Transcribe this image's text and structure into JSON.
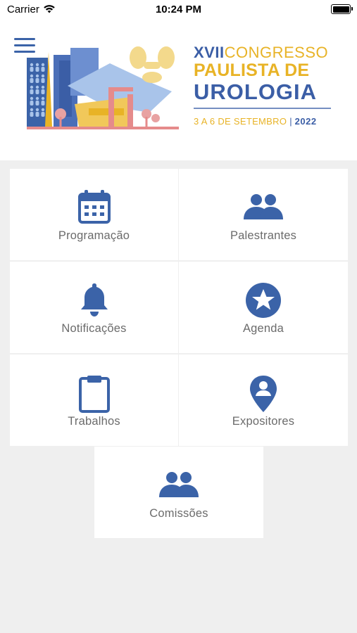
{
  "status_bar": {
    "carrier": "Carrier",
    "time": "10:24 PM"
  },
  "header": {
    "menu_icon": "hamburger-menu-icon",
    "brand": {
      "line1_roman": "XVII",
      "line1_word": "CONGRESSO",
      "line2": "PAULISTA DE",
      "line3": "UROLOGIA",
      "dates": "3 A 6 DE SETEMBRO",
      "separator": "|",
      "year": "2022"
    }
  },
  "menu": {
    "items": [
      {
        "label": "Programação",
        "icon": "calendar-icon"
      },
      {
        "label": "Palestrantes",
        "icon": "people-icon"
      },
      {
        "label": "Notificações",
        "icon": "bell-icon"
      },
      {
        "label": "Agenda",
        "icon": "star-circle-icon"
      },
      {
        "label": "Trabalhos",
        "icon": "clipboard-icon"
      },
      {
        "label": "Expositores",
        "icon": "location-pin-icon"
      },
      {
        "label": "Comissões",
        "icon": "people-icon"
      }
    ]
  },
  "colors": {
    "accent_blue": "#3b63a8",
    "brand_gold": "#e8b326",
    "label_gray": "#6b6b6b",
    "background": "#efefef"
  }
}
